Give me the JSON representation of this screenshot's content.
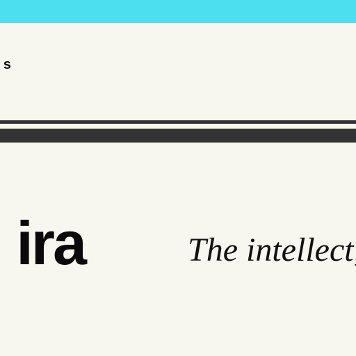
{
  "header": {
    "bar_color": "#4cdff0",
    "nav_text": "s"
  },
  "dividers": {
    "color": "#333333"
  },
  "hero": {
    "wordmark": "ira",
    "tagline": "The intellect,"
  },
  "colors": {
    "background": "#f7f6ef",
    "text": "#0a0a0a"
  }
}
